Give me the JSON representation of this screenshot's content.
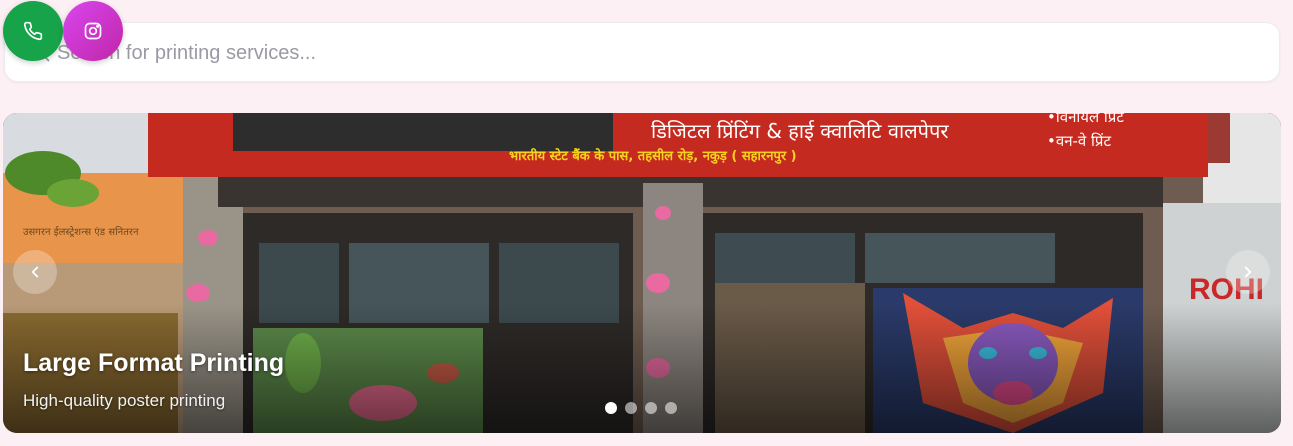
{
  "search": {
    "placeholder": "Search for printing services..."
  },
  "quick_actions": [
    {
      "name": "phone",
      "icon": "phone-icon",
      "color": "#17a34a"
    },
    {
      "name": "instagram",
      "icon": "instagram-icon",
      "color": "#c93fd6"
    }
  ],
  "carousel": {
    "slide": {
      "title": "Large Format Printing",
      "subtitle": "High-quality poster printing",
      "sign_line_1": "डिजिटल प्रिंटिंग & हाई क्वालिटि वालपेपर",
      "sign_line_2": "भारतीय स्टेट बैंक के पास, तहसील रोड़, नकुड़ ( सहारनपुर )",
      "sign_right_1": "•विनायल प्रिंट",
      "sign_right_2": "•वन-वे प्रिंट",
      "left_sign": "उसगरन ईलस्ट्रेशन्स एंड सनितरन",
      "right_sign": "ROHI"
    },
    "slide_count": 4,
    "active_index": 0,
    "prev_icon": "chevron-left-icon",
    "next_icon": "chevron-right-icon"
  },
  "colors": {
    "page_bg": "#fdf0f5",
    "sign_red": "#c42a1f",
    "sign_yellow": "#f7d21c"
  }
}
